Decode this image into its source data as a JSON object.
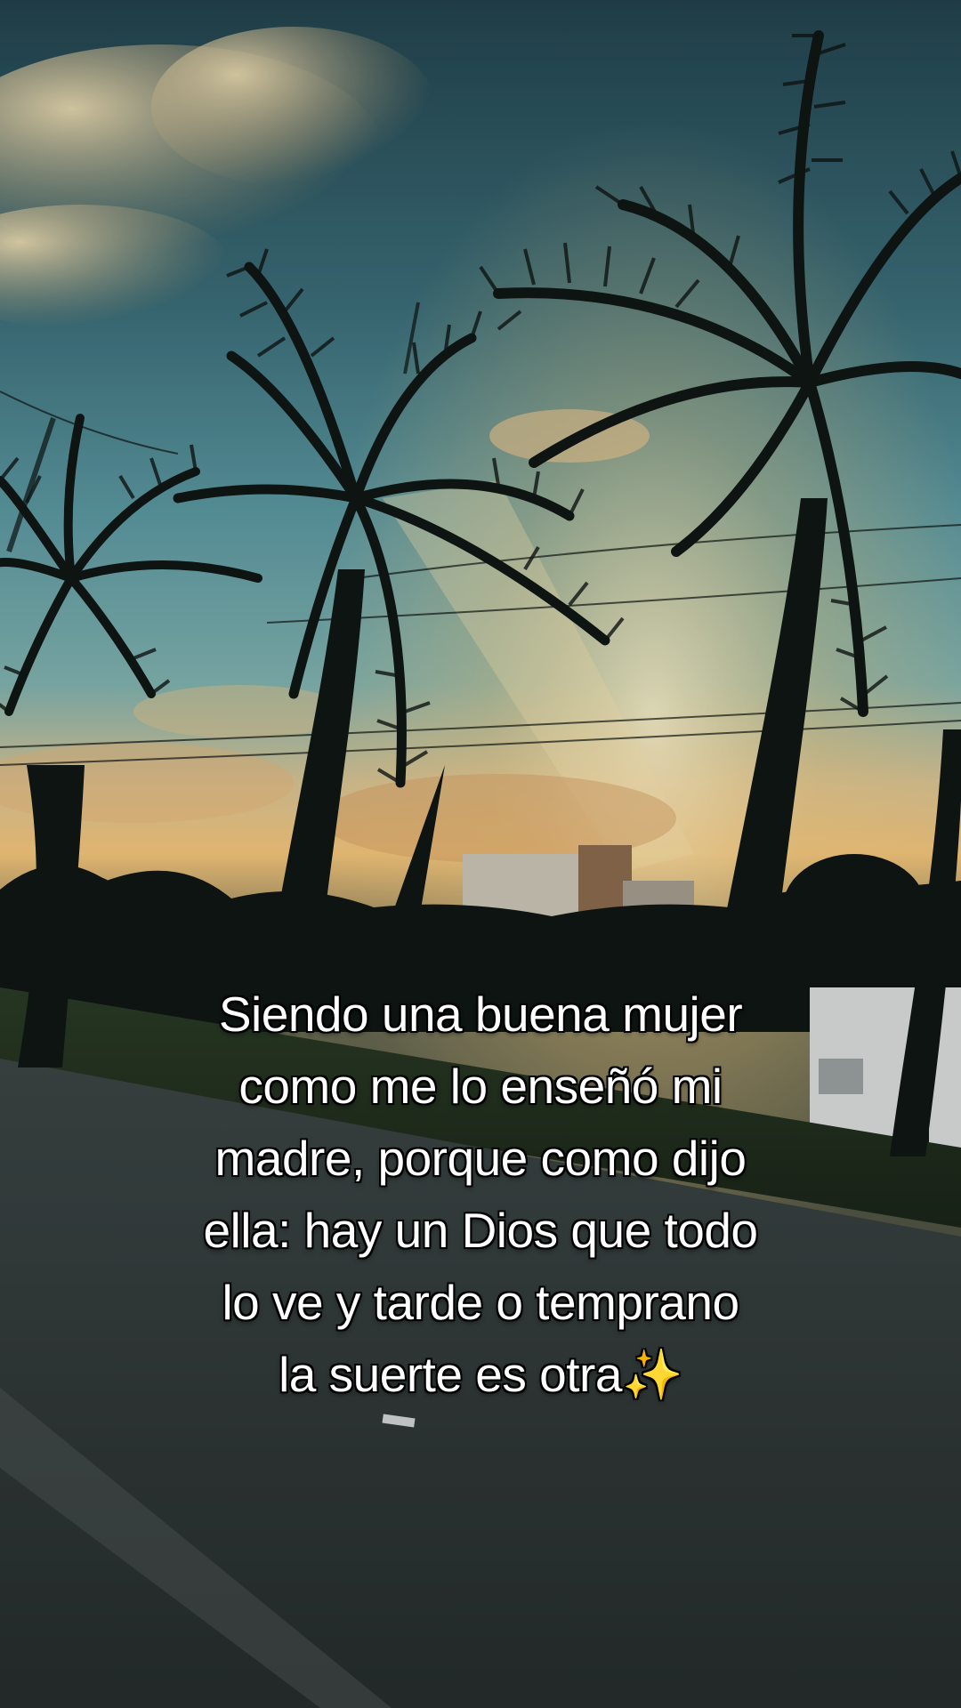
{
  "caption": {
    "lines": [
      "Siendo una buena mujer",
      "como me lo enseñó mi",
      "madre, porque como dijo",
      "ella: hay un Dios que todo",
      "lo ve y tarde o temprano",
      "la suerte es otra"
    ],
    "emoji": "✨"
  },
  "colors": {
    "sky_top": "#2f5a66",
    "sky_mid": "#4f8f9a",
    "horizon_glow": "#f2c27a",
    "cloud": "#e9d3a6",
    "silhouette": "#0f1614",
    "road": "#3a4242",
    "caption_text": "#ffffff"
  },
  "icons": [
    "sparkles-icon"
  ]
}
